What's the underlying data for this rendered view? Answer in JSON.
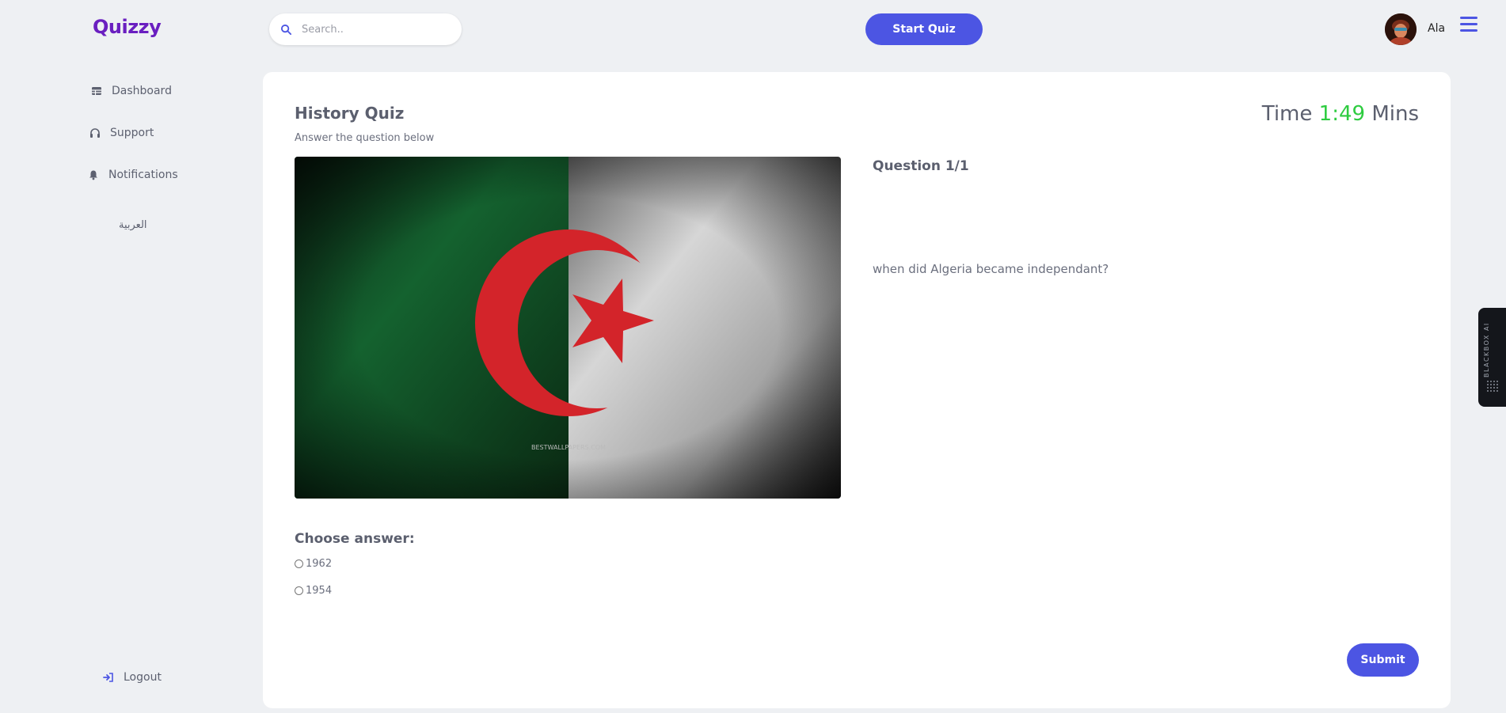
{
  "header": {
    "logo": "Quizzy",
    "search_placeholder": "Search..",
    "start_button": "Start Quiz",
    "username": "Ala"
  },
  "sidebar": {
    "items": [
      {
        "label": "Dashboard",
        "icon": "table-icon"
      },
      {
        "label": "Support",
        "icon": "headphones-icon"
      },
      {
        "label": "Notifications",
        "icon": "bell-icon"
      }
    ],
    "language": "العربية",
    "logout": "Logout"
  },
  "quiz": {
    "title": "History Quiz",
    "subtitle": "Answer the question below",
    "time_label": "Time",
    "time_value": "1:49",
    "time_unit": "Mins",
    "question_number": "Question 1/1",
    "question_text": "when did Algeria became independant?",
    "choose_label": "Choose answer:",
    "answers": [
      "1962",
      "1954"
    ],
    "submit": "Submit",
    "image_watermark": "BESTWALLPAPERS.COM"
  },
  "extension": {
    "label": "BLACKBOX AI"
  },
  "colors": {
    "accent": "#4c55e3",
    "logo": "#6a1fc0",
    "timer_value": "#2ecc40",
    "background": "#eef0f3"
  }
}
